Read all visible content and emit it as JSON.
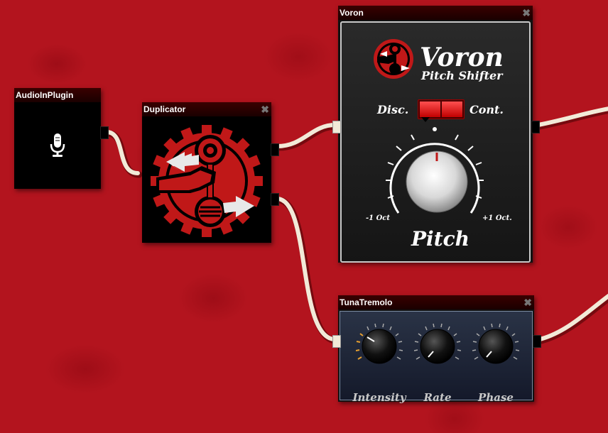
{
  "plugins": {
    "audio_in": {
      "title": "AudioInPlugin",
      "icon": "microphone-icon"
    },
    "duplicator": {
      "title": "Duplicator",
      "icon": "duplicator-logo-icon"
    },
    "voron": {
      "title": "Voron",
      "logo_title": "Voron",
      "logo_subtitle": "Pitch Shifter",
      "switch_left_label": "Disc.",
      "switch_right_label": "Cont.",
      "knob_min_label": "-1 Oct",
      "knob_max_label": "+1 Oct.",
      "knob_label": "Pitch",
      "mode": "Cont.",
      "pitch_value": 0
    },
    "tremolo": {
      "title": "TunaTremolo",
      "knobs": [
        {
          "label": "Intensity"
        },
        {
          "label": "Rate"
        },
        {
          "label": "Phase"
        }
      ]
    }
  },
  "colors": {
    "background": "#b3141e",
    "titlebar": "#2a0000",
    "wire": "#f2ead8",
    "accent_red": "#c01818"
  }
}
